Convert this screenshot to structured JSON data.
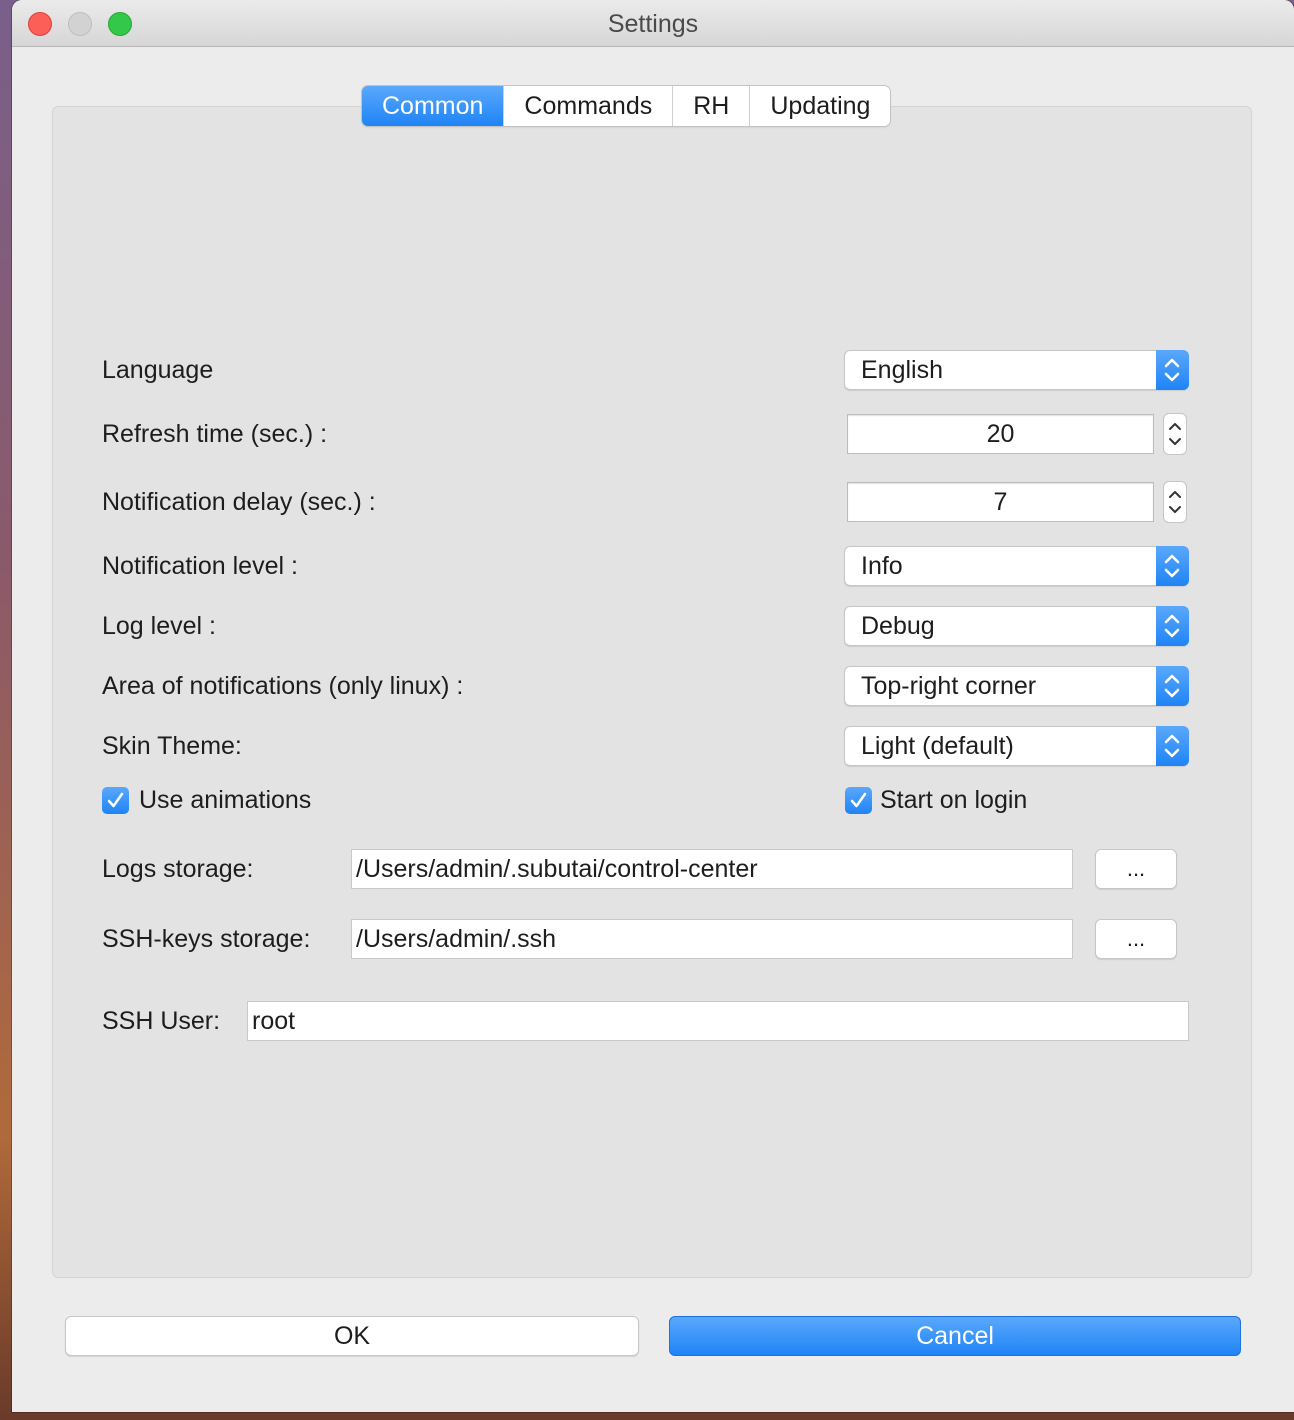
{
  "window": {
    "title": "Settings"
  },
  "tabs": [
    {
      "label": "Common",
      "active": true
    },
    {
      "label": "Commands",
      "active": false
    },
    {
      "label": "RH",
      "active": false
    },
    {
      "label": "Updating",
      "active": false
    }
  ],
  "common": {
    "language": {
      "label": "Language",
      "value": "English"
    },
    "refresh_time": {
      "label": "Refresh time (sec.) :",
      "value": "20"
    },
    "notification_delay": {
      "label": "Notification delay (sec.) :",
      "value": "7"
    },
    "notification_level": {
      "label": "Notification level :",
      "value": "Info"
    },
    "log_level": {
      "label": "Log level :",
      "value": "Debug"
    },
    "notification_area": {
      "label": "Area of notifications (only linux) :",
      "value": "Top-right corner"
    },
    "skin_theme": {
      "label": "Skin Theme:",
      "value": "Light (default)"
    },
    "use_animations": {
      "label": "Use animations",
      "checked": true
    },
    "start_on_login": {
      "label": "Start on login",
      "checked": true
    },
    "logs_storage": {
      "label": "Logs storage:",
      "value": "/Users/admin/.subutai/control-center",
      "browse_label": "..."
    },
    "ssh_keys_storage": {
      "label": "SSH-keys storage:",
      "value": "/Users/admin/.ssh",
      "browse_label": "..."
    },
    "ssh_user": {
      "label": "SSH User:",
      "value": "root"
    }
  },
  "buttons": {
    "ok": "OK",
    "cancel": "Cancel"
  },
  "colors": {
    "accent": "#1f84f6",
    "panel": "#e3e3e3",
    "window": "#ececec"
  },
  "icons": {
    "close": "close-icon",
    "minimize": "minimize-icon",
    "maximize": "maximize-icon",
    "select_arrows": "chevron-updown-icon",
    "stepper": "stepper-arrows-icon",
    "check": "checkmark-icon"
  }
}
